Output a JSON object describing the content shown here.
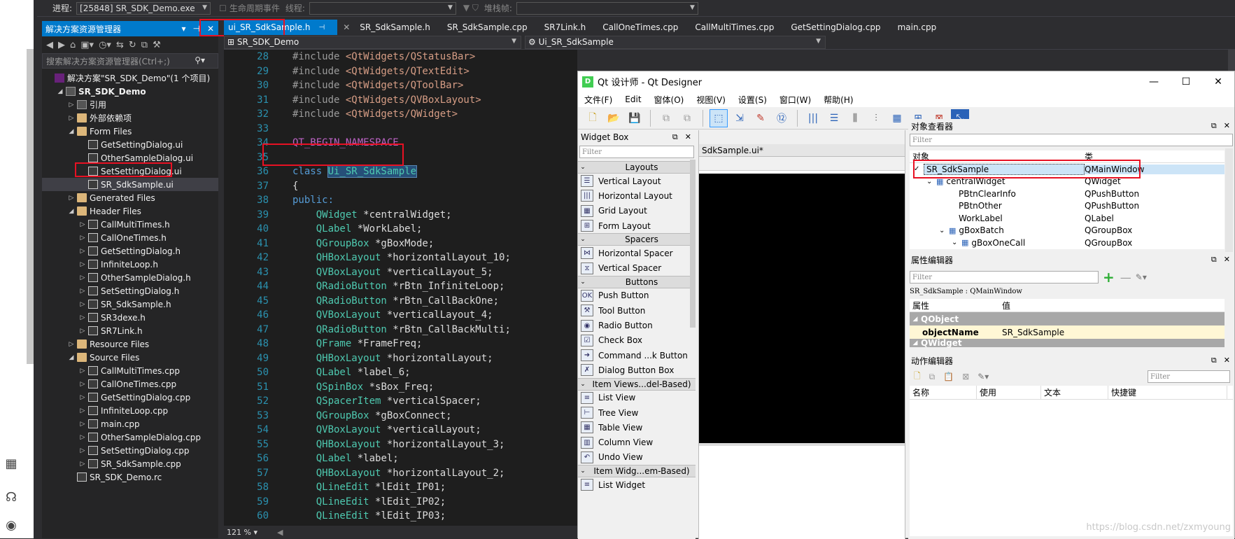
{
  "topbar": {
    "process_label": "进程:",
    "process_value": "[25848] SR_SDK_Demo.exe",
    "lifecycle_label": "生命周期事件",
    "thread_label": "线程:",
    "stack_label": "堆栈帧:"
  },
  "solution_explorer": {
    "title": "解决方案资源管理器",
    "search_placeholder": "搜索解决方案资源管理器(Ctrl+;)",
    "items": [
      {
        "label": "解决方案\"SR_SDK_Demo\"(1 个项目)",
        "level": 0,
        "icon": "solution-icon",
        "twisty": ""
      },
      {
        "label": "SR_SDK_Demo",
        "level": 1,
        "icon": "project-icon",
        "twisty": "◢",
        "bold": true
      },
      {
        "label": "引用",
        "level": 2,
        "icon": "references-icon",
        "twisty": "▷"
      },
      {
        "label": "外部依赖项",
        "level": 2,
        "icon": "folder-icon",
        "twisty": "▷"
      },
      {
        "label": "Form Files",
        "level": 2,
        "icon": "folder-icon",
        "twisty": "◢"
      },
      {
        "label": "GetSettingDialog.ui",
        "level": 3,
        "icon": "file-icon",
        "twisty": ""
      },
      {
        "label": "OtherSampleDialog.ui",
        "level": 3,
        "icon": "file-icon",
        "twisty": ""
      },
      {
        "label": "SetSettingDialog.ui",
        "level": 3,
        "icon": "file-icon",
        "twisty": ""
      },
      {
        "label": "SR_SdkSample.ui",
        "level": 3,
        "icon": "file-icon",
        "twisty": "",
        "selected": true
      },
      {
        "label": "Generated Files",
        "level": 2,
        "icon": "folder-icon",
        "twisty": "▷"
      },
      {
        "label": "Header Files",
        "level": 2,
        "icon": "folder-icon",
        "twisty": "◢"
      },
      {
        "label": "CallMultiTimes.h",
        "level": 3,
        "icon": "file-icon",
        "twisty": "▷"
      },
      {
        "label": "CallOneTimes.h",
        "level": 3,
        "icon": "file-icon",
        "twisty": "▷"
      },
      {
        "label": "GetSettingDialog.h",
        "level": 3,
        "icon": "file-icon",
        "twisty": "▷"
      },
      {
        "label": "InfiniteLoop.h",
        "level": 3,
        "icon": "file-icon",
        "twisty": "▷"
      },
      {
        "label": "OtherSampleDialog.h",
        "level": 3,
        "icon": "file-icon",
        "twisty": "▷"
      },
      {
        "label": "SetSettingDialog.h",
        "level": 3,
        "icon": "file-icon",
        "twisty": "▷"
      },
      {
        "label": "SR_SdkSample.h",
        "level": 3,
        "icon": "file-icon",
        "twisty": "▷"
      },
      {
        "label": "SR3dexe.h",
        "level": 3,
        "icon": "file-icon",
        "twisty": "▷"
      },
      {
        "label": "SR7Link.h",
        "level": 3,
        "icon": "file-icon",
        "twisty": "▷"
      },
      {
        "label": "Resource Files",
        "level": 2,
        "icon": "folder-icon",
        "twisty": "▷"
      },
      {
        "label": "Source Files",
        "level": 2,
        "icon": "folder-icon",
        "twisty": "◢"
      },
      {
        "label": "CallMultiTimes.cpp",
        "level": 3,
        "icon": "file-icon",
        "twisty": "▷"
      },
      {
        "label": "CallOneTimes.cpp",
        "level": 3,
        "icon": "file-icon",
        "twisty": "▷"
      },
      {
        "label": "GetSettingDialog.cpp",
        "level": 3,
        "icon": "file-icon",
        "twisty": "▷"
      },
      {
        "label": "InfiniteLoop.cpp",
        "level": 3,
        "icon": "file-icon",
        "twisty": "▷"
      },
      {
        "label": "main.cpp",
        "level": 3,
        "icon": "file-icon",
        "twisty": "▷"
      },
      {
        "label": "OtherSampleDialog.cpp",
        "level": 3,
        "icon": "file-icon",
        "twisty": "▷"
      },
      {
        "label": "SetSettingDialog.cpp",
        "level": 3,
        "icon": "file-icon",
        "twisty": "▷"
      },
      {
        "label": "SR_SdkSample.cpp",
        "level": 3,
        "icon": "file-icon",
        "twisty": "▷"
      },
      {
        "label": "SR_SDK_Demo.rc",
        "level": 2,
        "icon": "file-icon",
        "twisty": ""
      }
    ]
  },
  "editor": {
    "tabs": [
      {
        "label": "ui_SR_SdkSample.h",
        "active": true
      },
      {
        "label": "SR_SdkSample.h"
      },
      {
        "label": "SR_SdkSample.cpp"
      },
      {
        "label": "SR7Link.h"
      },
      {
        "label": "CallOneTimes.cpp"
      },
      {
        "label": "CallMultiTimes.cpp"
      },
      {
        "label": "GetSettingDialog.cpp"
      },
      {
        "label": "main.cpp"
      }
    ],
    "nav_project": "SR_SDK_Demo",
    "nav_scope": "Ui_SR_SdkSample",
    "zoom": "121 %",
    "lines": [
      {
        "n": "28",
        "kind": "inc",
        "pre": "#include ",
        "text": "<QtWidgets/QStatusBar>"
      },
      {
        "n": "29",
        "kind": "inc",
        "pre": "#include ",
        "text": "<QtWidgets/QTextEdit>"
      },
      {
        "n": "30",
        "kind": "inc",
        "pre": "#include ",
        "text": "<QtWidgets/QToolBar>"
      },
      {
        "n": "31",
        "kind": "inc",
        "pre": "#include ",
        "text": "<QtWidgets/QVBoxLayout>"
      },
      {
        "n": "32",
        "kind": "inc",
        "pre": "#include ",
        "text": "<QtWidgets/QWidget>"
      },
      {
        "n": "33",
        "kind": "blank"
      },
      {
        "n": "34",
        "kind": "mac",
        "text": "QT_BEGIN_NAMESPACE"
      },
      {
        "n": "35",
        "kind": "blank"
      },
      {
        "n": "36",
        "kind": "class",
        "pre": "class ",
        "text": "Ui_SR_SdkSample"
      },
      {
        "n": "37",
        "kind": "plain",
        "text": "{"
      },
      {
        "n": "38",
        "kind": "kw",
        "text": "public:"
      },
      {
        "n": "39",
        "kind": "decl",
        "type": "QWidget",
        "rest": " *centralWidget;"
      },
      {
        "n": "40",
        "kind": "decl",
        "type": "QLabel",
        "rest": " *WorkLabel;"
      },
      {
        "n": "41",
        "kind": "decl",
        "type": "QGroupBox",
        "rest": " *gBoxMode;"
      },
      {
        "n": "42",
        "kind": "decl",
        "type": "QHBoxLayout",
        "rest": " *horizontalLayout_10;"
      },
      {
        "n": "43",
        "kind": "decl",
        "type": "QVBoxLayout",
        "rest": " *verticalLayout_5;"
      },
      {
        "n": "44",
        "kind": "decl",
        "type": "QRadioButton",
        "rest": " *rBtn_InfiniteLoop;"
      },
      {
        "n": "45",
        "kind": "decl",
        "type": "QRadioButton",
        "rest": " *rBtn_CallBackOne;"
      },
      {
        "n": "46",
        "kind": "decl",
        "type": "QVBoxLayout",
        "rest": " *verticalLayout_4;"
      },
      {
        "n": "47",
        "kind": "decl",
        "type": "QRadioButton",
        "rest": " *rBtn_CallBackMulti;"
      },
      {
        "n": "48",
        "kind": "decl",
        "type": "QFrame",
        "rest": " *FrameFreq;"
      },
      {
        "n": "49",
        "kind": "decl",
        "type": "QHBoxLayout",
        "rest": " *horizontalLayout;"
      },
      {
        "n": "50",
        "kind": "decl",
        "type": "QLabel",
        "rest": " *label_6;"
      },
      {
        "n": "51",
        "kind": "decl",
        "type": "QSpinBox",
        "rest": " *sBox_Freq;"
      },
      {
        "n": "52",
        "kind": "decl",
        "type": "QSpacerItem",
        "rest": " *verticalSpacer;"
      },
      {
        "n": "53",
        "kind": "decl",
        "type": "QGroupBox",
        "rest": " *gBoxConnect;"
      },
      {
        "n": "54",
        "kind": "decl",
        "type": "QVBoxLayout",
        "rest": " *verticalLayout;"
      },
      {
        "n": "55",
        "kind": "decl",
        "type": "QHBoxLayout",
        "rest": " *horizontalLayout_3;"
      },
      {
        "n": "56",
        "kind": "decl",
        "type": "QLabel",
        "rest": " *label;"
      },
      {
        "n": "57",
        "kind": "decl",
        "type": "QHBoxLayout",
        "rest": " *horizontalLayout_2;"
      },
      {
        "n": "58",
        "kind": "decl",
        "type": "QLineEdit",
        "rest": " *lEdit_IP01;"
      },
      {
        "n": "59",
        "kind": "decl",
        "type": "QLineEdit",
        "rest": " *lEdit_IP02;"
      },
      {
        "n": "60",
        "kind": "decl",
        "type": "QLineEdit",
        "rest": " *lEdit_IP03;"
      }
    ]
  },
  "qt_designer": {
    "title": "Qt 设计师 - Qt Designer",
    "logo": "D",
    "menu": [
      "文件(F)",
      "Edit",
      "窗体(O)",
      "视图(V)",
      "设置(S)",
      "窗口(W)",
      "帮助(H)"
    ],
    "widget_box": {
      "title": "Widget Box",
      "filter_placeholder": "Filter",
      "sections": [
        {
          "label": "Layouts",
          "items": [
            "Vertical Layout",
            "Horizontal Layout",
            "Grid Layout",
            "Form Layout"
          ]
        },
        {
          "label": "Spacers",
          "items": [
            "Horizontal Spacer",
            "Vertical Spacer"
          ]
        },
        {
          "label": "Buttons",
          "items": [
            "Push Button",
            "Tool Button",
            "Radio Button",
            "Check Box",
            "Command ...k Button",
            "Dialog Button Box"
          ]
        },
        {
          "label": "Item Views...del-Based)",
          "items": [
            "List View",
            "Tree View",
            "Table View",
            "Column View",
            "Undo View"
          ]
        },
        {
          "label": "Item Widg...em-Based)",
          "items": [
            "List Widget"
          ]
        }
      ]
    },
    "form_tab": "SdkSample.ui*",
    "object_inspector": {
      "title": "对象查看器",
      "filter_placeholder": "Filter",
      "col_object": "对象",
      "col_class": "类",
      "rows": [
        {
          "name": "SR_SdkSample",
          "cls": "QMainWindow",
          "indent": 0,
          "twisty": "✓",
          "selected": true
        },
        {
          "name": "centralWidget",
          "cls": "QWidget",
          "indent": 1,
          "twisty": "⌄",
          "icon": true
        },
        {
          "name": "PBtnClearInfo",
          "cls": "QPushButton",
          "indent": 2,
          "twisty": ""
        },
        {
          "name": "PBtnOther",
          "cls": "QPushButton",
          "indent": 2,
          "twisty": ""
        },
        {
          "name": "WorkLabel",
          "cls": "QLabel",
          "indent": 2,
          "twisty": ""
        },
        {
          "name": "gBoxBatch",
          "cls": "QGroupBox",
          "indent": 2,
          "twisty": "⌄",
          "icon": true
        },
        {
          "name": "gBoxOneCall",
          "cls": "QGroupBox",
          "indent": 3,
          "twisty": "⌄",
          "icon": true
        }
      ]
    },
    "property_editor": {
      "title": "属性编辑器",
      "filter_placeholder": "Filter",
      "caption": "SR_SdkSample : QMainWindow",
      "col_property": "属性",
      "col_value": "值",
      "group1": "QObject",
      "prop_name": "objectName",
      "prop_value": "SR_SdkSample",
      "group2": "QWidget"
    },
    "action_editor": {
      "title": "动作编辑器",
      "filter_placeholder": "Filter",
      "cols": [
        "名称",
        "使用",
        "文本",
        "快捷键"
      ]
    }
  },
  "watermark": "https://blog.csdn.net/zxmyoung",
  "colors": {
    "accent": "#007acc",
    "highlight_box": "#e81123"
  }
}
